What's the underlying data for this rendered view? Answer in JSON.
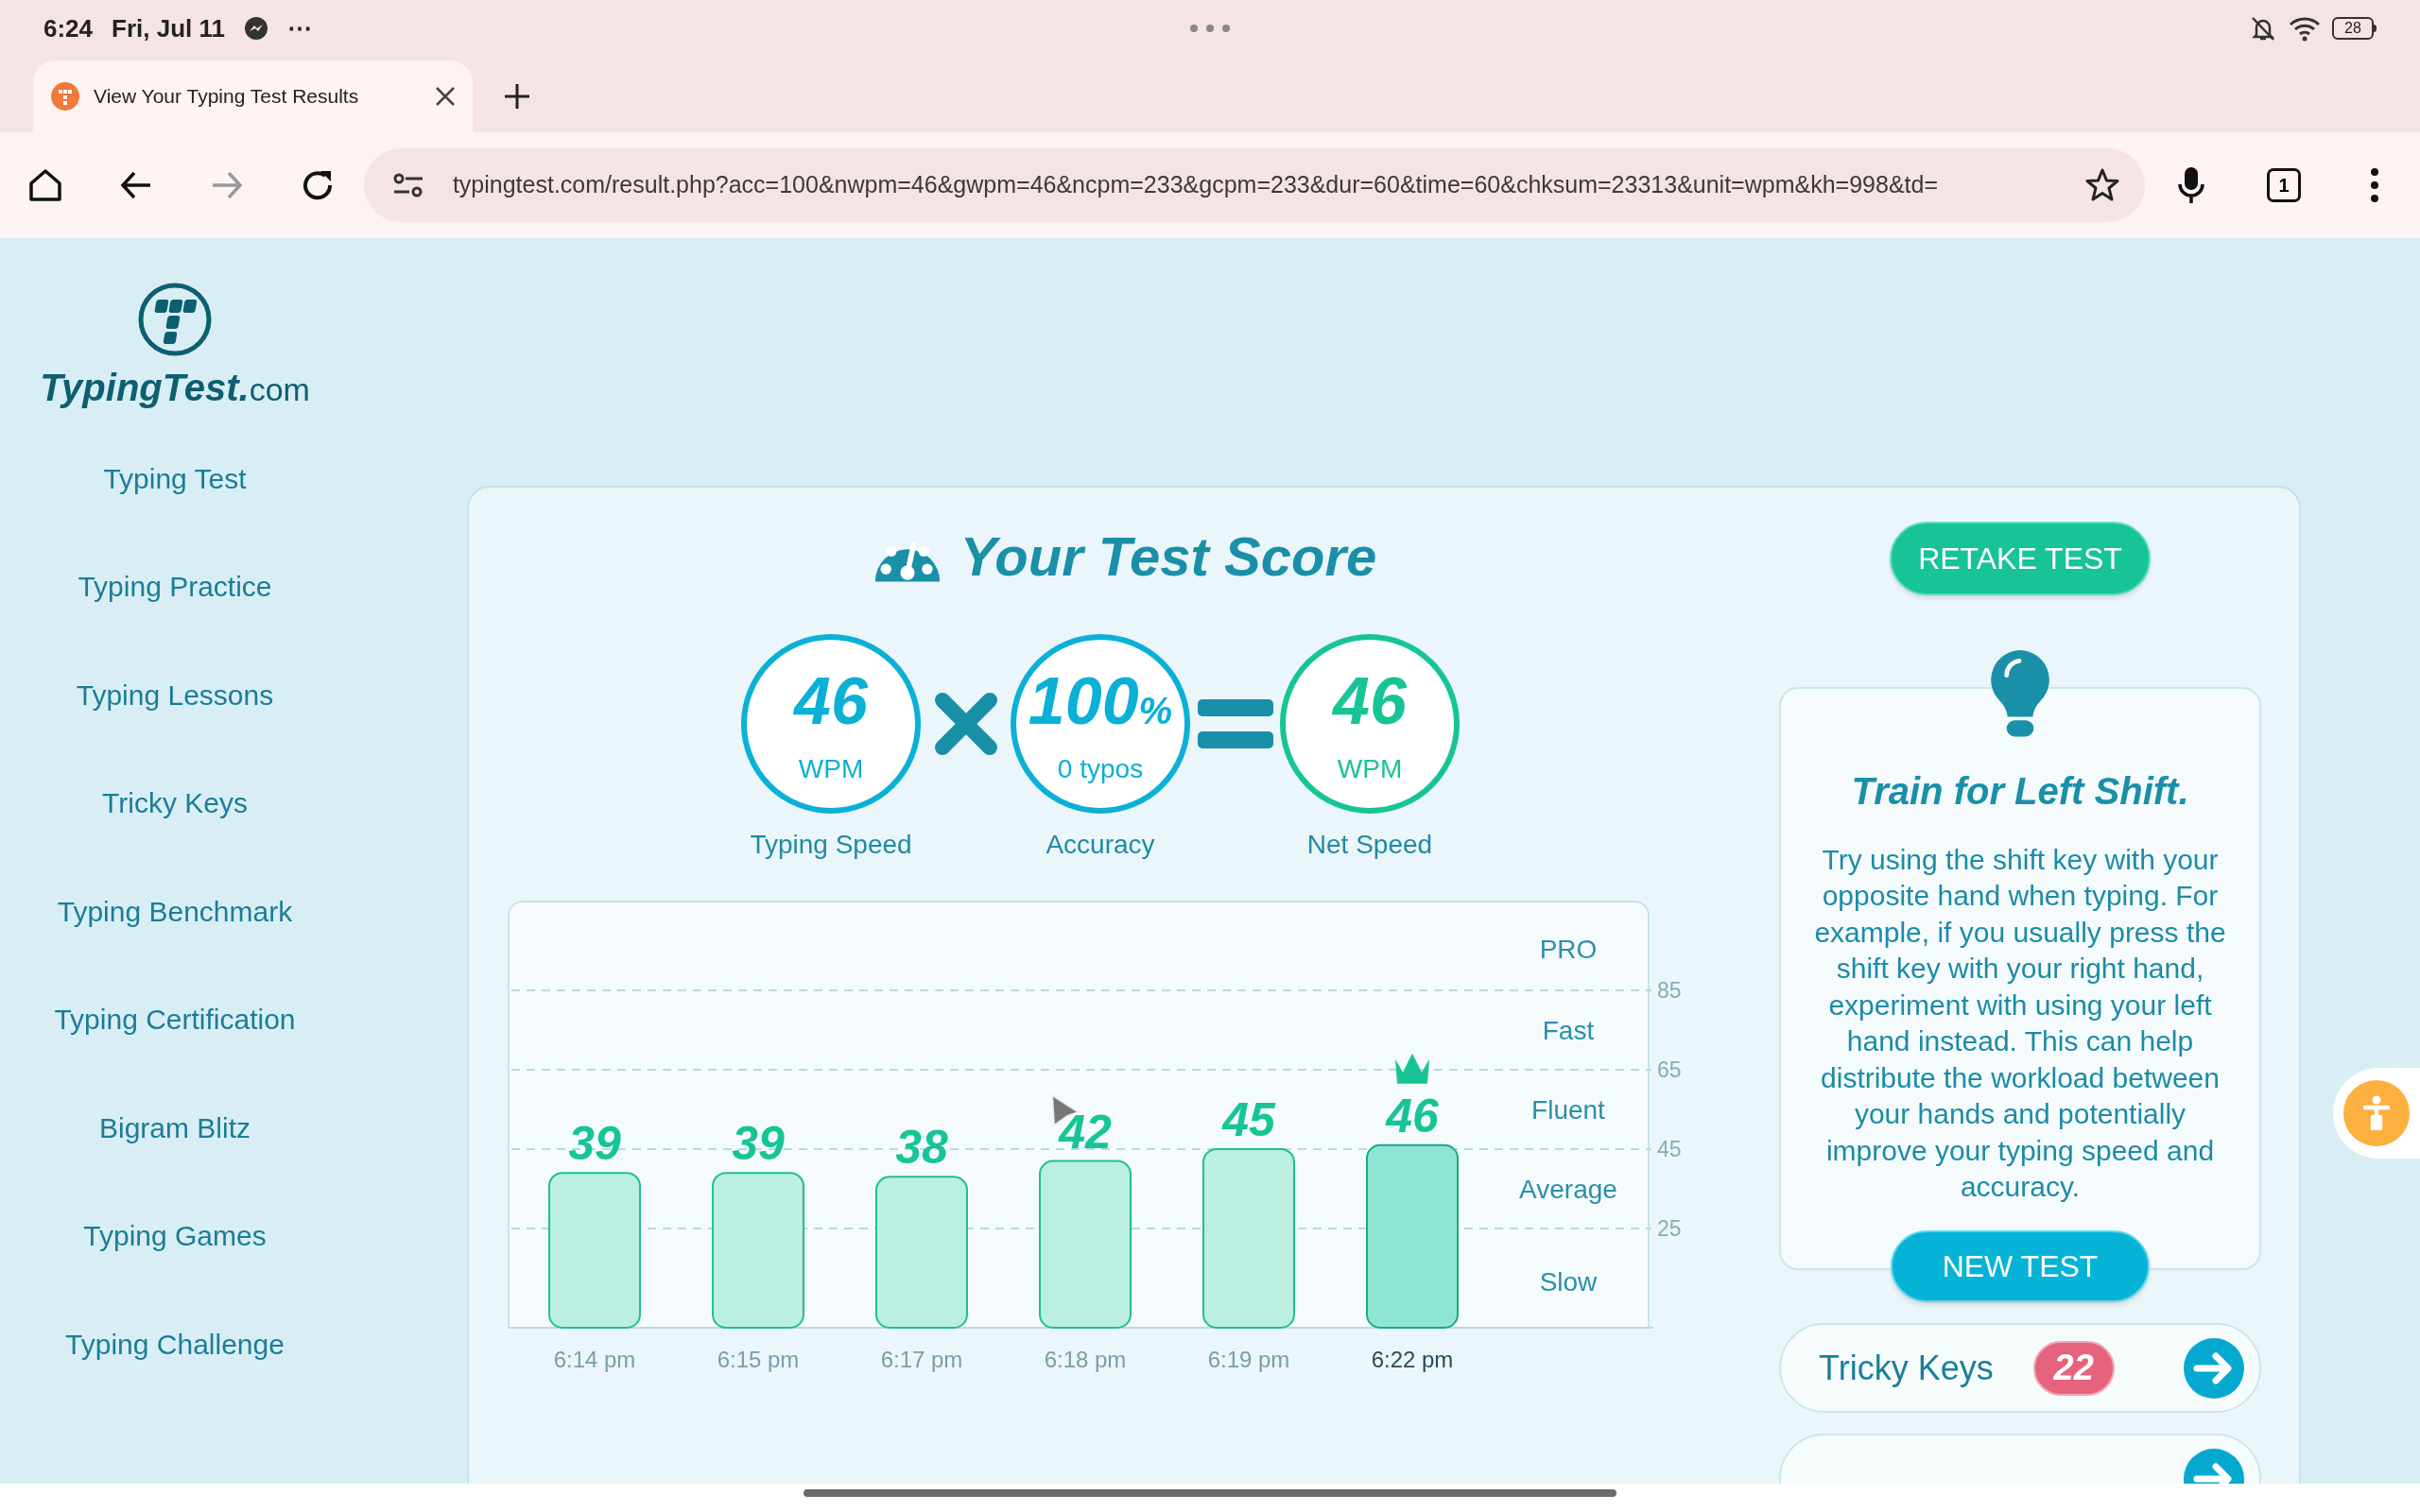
{
  "status_bar": {
    "time": "6:24",
    "date": "Fri, Jul 11",
    "more": "⋯",
    "battery": "28"
  },
  "browser": {
    "tab": {
      "title": "View Your Typing Test Results",
      "selected": true
    },
    "url": "typingtest.com/result.php?acc=100&nwpm=46&gwpm=46&ncpm=233&gcpm=233&dur=60&time=60&chksum=23313&unit=wpm&kh=998&td=",
    "tab_count": "1"
  },
  "sidebar": {
    "logo": {
      "brand": "TypingTest.",
      "tld": "com"
    },
    "items": [
      "Typing Test",
      "Typing Practice",
      "Typing Lessons",
      "Tricky Keys",
      "Typing Benchmark",
      "Typing Certification",
      "Bigram Blitz",
      "Typing Games",
      "Typing Challenge"
    ]
  },
  "score": {
    "title": "Your Test Score",
    "circles": [
      {
        "value": "46",
        "unit": "WPM",
        "label": "Typing Speed",
        "color": "#0ab0d6"
      },
      {
        "value": "100",
        "suffix": "%",
        "unit": "0 typos",
        "label": "Accuracy",
        "color": "#0ab0d6"
      },
      {
        "value": "46",
        "unit": "WPM",
        "label": "Net Speed",
        "color": "#17c496"
      }
    ],
    "chart": {
      "chart_data": {
        "type": "bar",
        "categories": [
          "6:14 pm",
          "6:15 pm",
          "6:17 pm",
          "6:18 pm",
          "6:19 pm",
          "6:22 pm"
        ],
        "values": [
          39,
          39,
          38,
          42,
          45,
          46
        ],
        "ylim": [
          0,
          107.6
        ],
        "yticks": [
          25,
          45,
          65,
          85
        ],
        "grid": true,
        "data_labels": true,
        "annotations": [
          "PRO",
          "Fast",
          "Fluent",
          "Average",
          "Slow"
        ]
      },
      "bars": [
        {
          "best": false
        },
        {
          "best": false
        },
        {
          "best": false
        },
        {
          "best": false
        },
        {
          "best": false
        },
        {
          "best": true
        }
      ]
    }
  },
  "retake_button": "RETAKE TEST",
  "tip": {
    "title": "Train for Left Shift.",
    "body": "Try using the shift key with your opposite hand when typing. For example, if you usually press the shift key with your right hand, experiment with using your left hand instead. This can help distribute the workload between your hands and potentially improve your typing speed and accuracy.",
    "button": "NEW TEST"
  },
  "links": [
    {
      "kind": "full",
      "label": "Tricky Keys",
      "badge": "22"
    },
    {
      "kind": "cut"
    }
  ]
}
